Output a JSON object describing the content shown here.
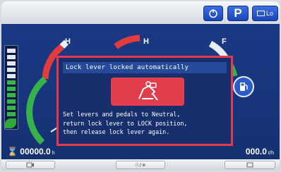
{
  "topbar": {
    "eco_icon": "eco-mode-icon",
    "p_label": "P",
    "lo_label": "Lo"
  },
  "gauges": {
    "left_label": "H",
    "middle_label": "H",
    "right_label": "F"
  },
  "alert": {
    "title": "Lock lever locked automatically",
    "icon": "operator-lock-warning-icon",
    "body": "Set levers and pedals to Neutral,\nreturn lock lever to LOCK position,\nthen release lock lever again.",
    "border_color": "#e53a4e"
  },
  "status": {
    "hours_value": "00000.0",
    "hours_unit": "h",
    "flow_value": "000.0",
    "flow_unit": "ℓ/h"
  },
  "softkeys": {
    "middle_label": "☉/☀"
  }
}
